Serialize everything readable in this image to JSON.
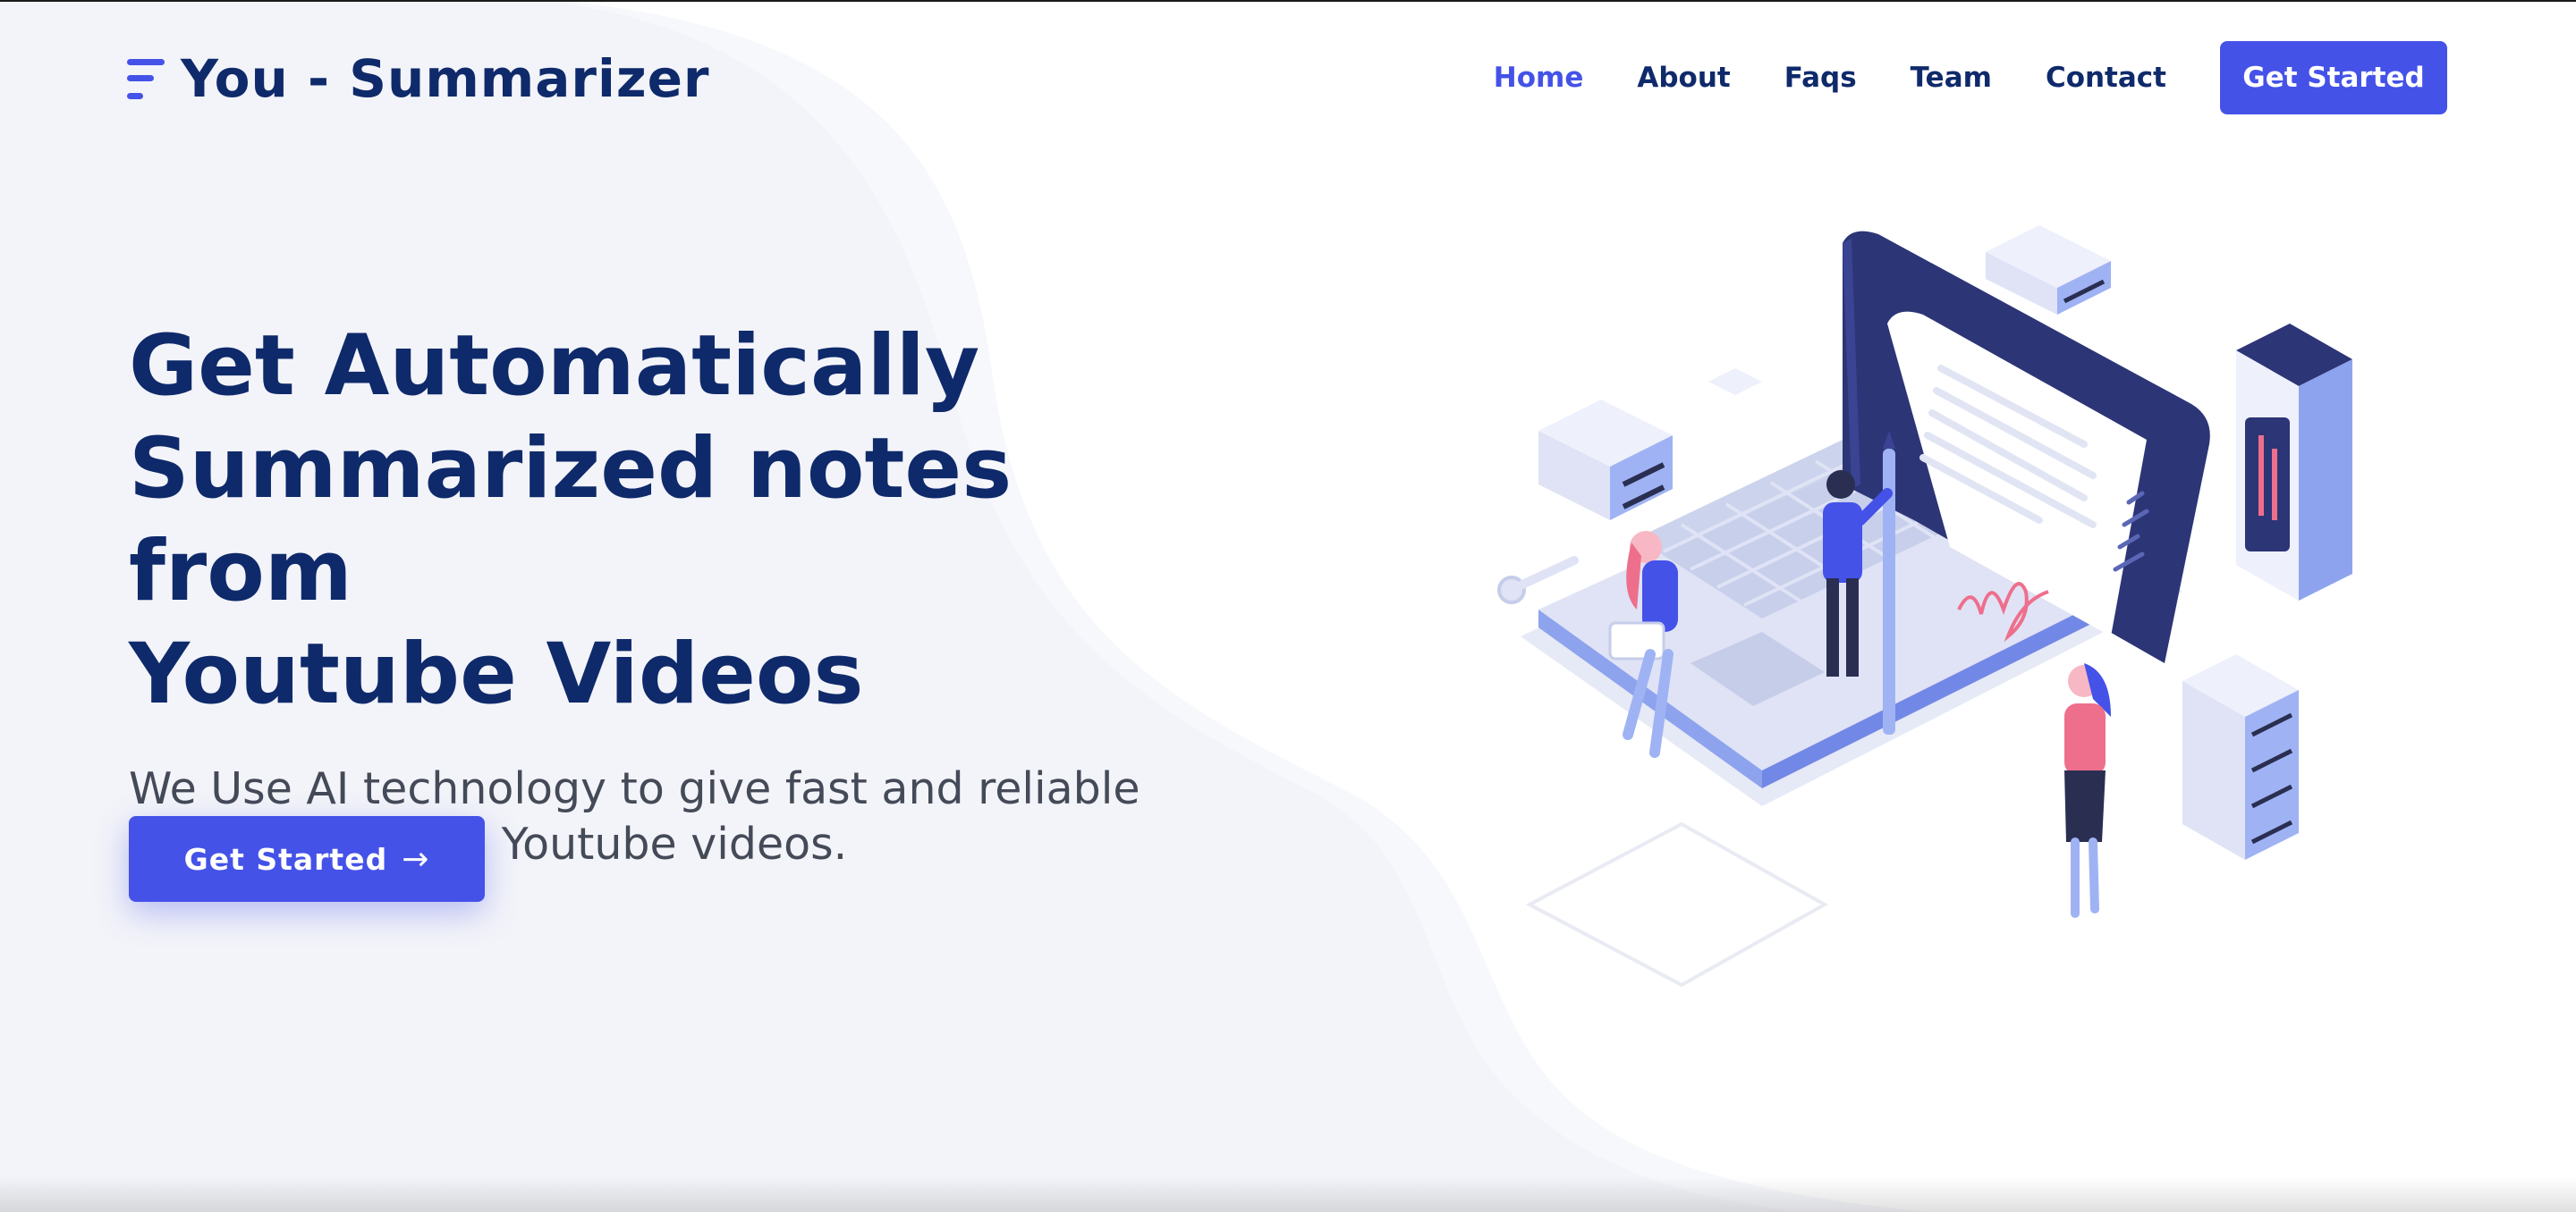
{
  "brand": {
    "name": "You - Summarizer",
    "accent_color": "#4452e8",
    "heading_color": "#0f2a6b",
    "logo_icon": "menu-lines-icon"
  },
  "nav": {
    "items": [
      {
        "label": "Home",
        "active": true
      },
      {
        "label": "About",
        "active": false
      },
      {
        "label": "Faqs",
        "active": false
      },
      {
        "label": "Team",
        "active": false
      },
      {
        "label": "Contact",
        "active": false
      }
    ],
    "cta_label": "Get Started"
  },
  "hero": {
    "title_lines": [
      "Get Automatically",
      "Summarized notes from",
      "Youtube Videos"
    ],
    "subtitle_lines": [
      "We Use AI technology to give fast and reliable",
      "summaries from Youtube videos."
    ],
    "cta_label": "Get Started",
    "cta_icon": "arrow-right-icon",
    "illustration": "isometric-laptop-document-people-servers-illustration"
  }
}
